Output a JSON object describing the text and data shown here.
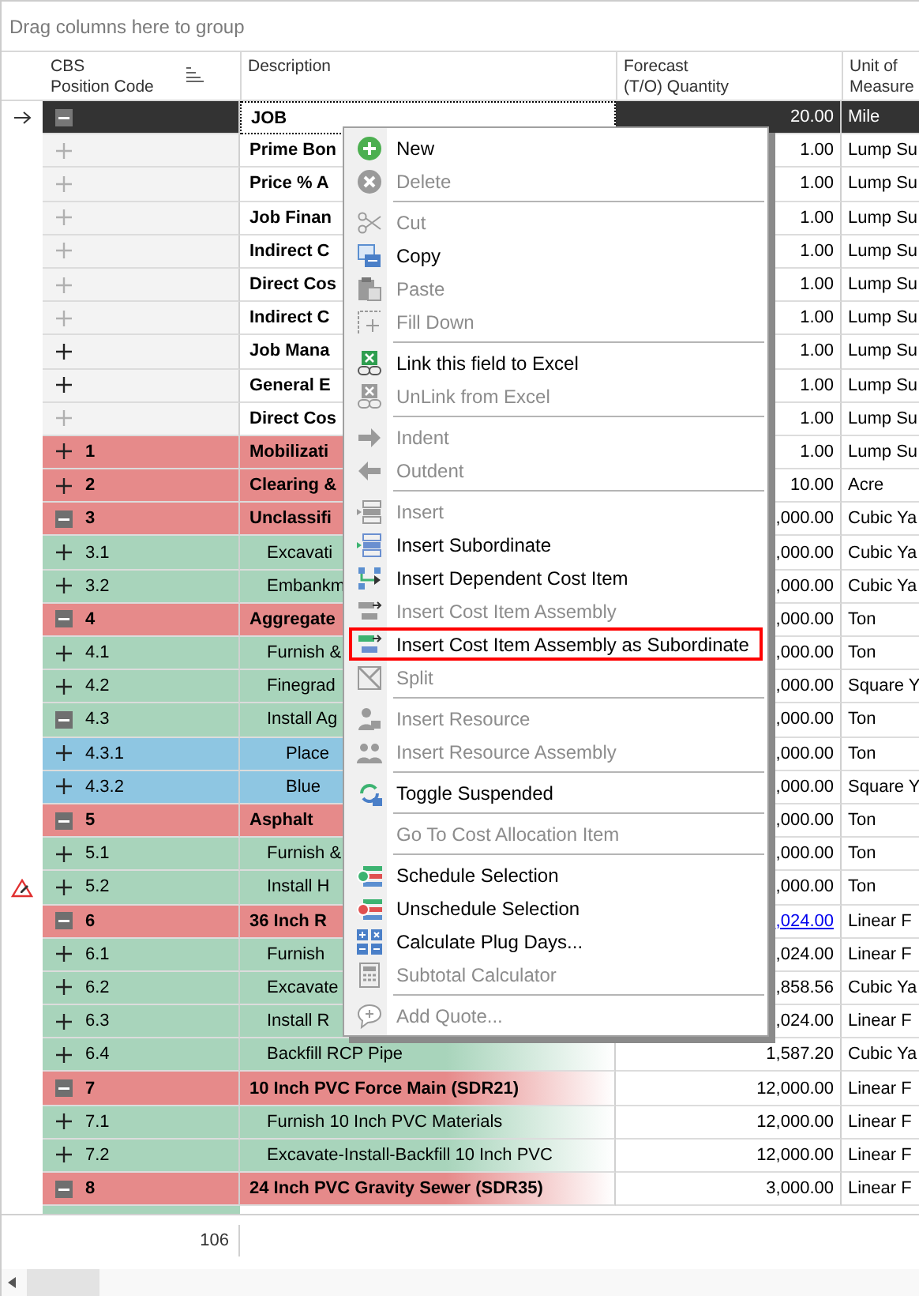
{
  "group_panel": {
    "placeholder": "Drag columns here to group"
  },
  "columns": [
    {
      "label": "CBS\nPosition Code",
      "sorted": true
    },
    {
      "label": "Description"
    },
    {
      "label": "Forecast\n(T/O) Quantity"
    },
    {
      "label": "Unit of\nMeasure"
    }
  ],
  "rows": [
    {
      "code": "",
      "description": "JOB",
      "forecast": "20.00",
      "unit": "Mile",
      "kind": "job",
      "expanded": true,
      "disabled": false,
      "selected": true,
      "link": false,
      "current": true,
      "warning": false
    },
    {
      "code": "",
      "description": "Prime Bon",
      "forecast": "1.00",
      "unit": "Lump Su",
      "kind": "plain",
      "expanded": false,
      "disabled": true,
      "selected": false,
      "link": false,
      "current": false,
      "warning": false
    },
    {
      "code": "",
      "description": "Price % A",
      "forecast": "1.00",
      "unit": "Lump Su",
      "kind": "plain",
      "expanded": false,
      "disabled": true,
      "selected": false,
      "link": false,
      "current": false,
      "warning": false
    },
    {
      "code": "",
      "description": "Job Finan",
      "forecast": "1.00",
      "unit": "Lump Su",
      "kind": "plain",
      "expanded": false,
      "disabled": true,
      "selected": false,
      "link": false,
      "current": false,
      "warning": false
    },
    {
      "code": "",
      "description": "Indirect C",
      "forecast": "1.00",
      "unit": "Lump Su",
      "kind": "plain",
      "expanded": false,
      "disabled": true,
      "selected": false,
      "link": false,
      "current": false,
      "warning": false
    },
    {
      "code": "",
      "description": "Direct Cos",
      "forecast": "1.00",
      "unit": "Lump Su",
      "kind": "plain",
      "expanded": false,
      "disabled": true,
      "selected": false,
      "link": false,
      "current": false,
      "warning": false
    },
    {
      "code": "",
      "description": "Indirect C",
      "forecast": "1.00",
      "unit": "Lump Su",
      "kind": "plain",
      "expanded": false,
      "disabled": true,
      "selected": false,
      "link": false,
      "current": false,
      "warning": false
    },
    {
      "code": "",
      "description": "Job Mana",
      "forecast": "1.00",
      "unit": "Lump Su",
      "kind": "plain",
      "expanded": false,
      "disabled": false,
      "selected": false,
      "link": false,
      "current": false,
      "warning": false
    },
    {
      "code": "",
      "description": "General E",
      "forecast": "1.00",
      "unit": "Lump Su",
      "kind": "plain",
      "expanded": false,
      "disabled": false,
      "selected": false,
      "link": false,
      "current": false,
      "warning": false
    },
    {
      "code": "",
      "description": "Direct Cos",
      "forecast": "1.00",
      "unit": "Lump Su",
      "kind": "plain",
      "expanded": false,
      "disabled": true,
      "selected": false,
      "link": false,
      "current": false,
      "warning": false
    },
    {
      "code": "1",
      "description": "Mobilizati",
      "forecast": "1.00",
      "unit": "Lump Su",
      "kind": "section",
      "expanded": false,
      "disabled": false,
      "selected": false,
      "link": false,
      "current": false,
      "warning": false
    },
    {
      "code": "2",
      "description": "Clearing &",
      "forecast": "10.00",
      "unit": "Acre",
      "kind": "section",
      "expanded": false,
      "disabled": false,
      "selected": false,
      "link": false,
      "current": false,
      "warning": false
    },
    {
      "code": "3",
      "description": "Unclassifi",
      "forecast": ",000.00",
      "unit": "Cubic Ya",
      "kind": "section",
      "expanded": true,
      "disabled": false,
      "selected": false,
      "link": false,
      "current": false,
      "warning": false
    },
    {
      "code": "3.1",
      "description": "Excavati",
      "forecast": ",000.00",
      "unit": "Cubic Ya",
      "kind": "item",
      "expanded": false,
      "disabled": false,
      "selected": false,
      "link": false,
      "current": false,
      "warning": false
    },
    {
      "code": "3.2",
      "description": "Embankm",
      "forecast": ",000.00",
      "unit": "Cubic Ya",
      "kind": "item",
      "expanded": false,
      "disabled": false,
      "selected": false,
      "link": false,
      "current": false,
      "warning": false
    },
    {
      "code": "4",
      "description": "Aggregate",
      "forecast": ",000.00",
      "unit": "Ton",
      "kind": "section",
      "expanded": true,
      "disabled": false,
      "selected": false,
      "link": false,
      "current": false,
      "warning": false
    },
    {
      "code": "4.1",
      "description": "Furnish &",
      "forecast": ",000.00",
      "unit": "Ton",
      "kind": "item",
      "expanded": false,
      "disabled": false,
      "selected": false,
      "link": false,
      "current": false,
      "warning": false
    },
    {
      "code": "4.2",
      "description": "Finegrad",
      "forecast": ",000.00",
      "unit": "Square Y",
      "kind": "item",
      "expanded": false,
      "disabled": false,
      "selected": false,
      "link": false,
      "current": false,
      "warning": false
    },
    {
      "code": "4.3",
      "description": "Install Ag",
      "forecast": ",000.00",
      "unit": "Ton",
      "kind": "item",
      "expanded": true,
      "disabled": false,
      "selected": false,
      "link": false,
      "current": false,
      "warning": false
    },
    {
      "code": "4.3.1",
      "description": "Place",
      "forecast": ",000.00",
      "unit": "Ton",
      "kind": "subitem",
      "expanded": false,
      "disabled": false,
      "selected": false,
      "link": false,
      "current": false,
      "warning": false
    },
    {
      "code": "4.3.2",
      "description": "Blue",
      "forecast": ",000.00",
      "unit": "Square Y",
      "kind": "subitem",
      "expanded": false,
      "disabled": false,
      "selected": false,
      "link": false,
      "current": false,
      "warning": false
    },
    {
      "code": "5",
      "description": "Asphalt",
      "forecast": ",000.00",
      "unit": "Ton",
      "kind": "section",
      "expanded": true,
      "disabled": false,
      "selected": false,
      "link": false,
      "current": false,
      "warning": false
    },
    {
      "code": "5.1",
      "description": "Furnish &",
      "forecast": ",000.00",
      "unit": "Ton",
      "kind": "item",
      "expanded": false,
      "disabled": false,
      "selected": false,
      "link": false,
      "current": false,
      "warning": false
    },
    {
      "code": "5.2",
      "description": "Install H",
      "forecast": ",000.00",
      "unit": "Ton",
      "kind": "item",
      "expanded": false,
      "disabled": false,
      "selected": false,
      "link": false,
      "current": false,
      "warning": true
    },
    {
      "code": "6",
      "description": "36 Inch R",
      "forecast": ",024.00",
      "unit": "Linear F",
      "kind": "section",
      "expanded": true,
      "disabled": false,
      "selected": false,
      "link": true,
      "current": false,
      "warning": false
    },
    {
      "code": "6.1",
      "description": "Furnish",
      "forecast": ",024.00",
      "unit": "Linear F",
      "kind": "item",
      "expanded": false,
      "disabled": false,
      "selected": false,
      "link": false,
      "current": false,
      "warning": false
    },
    {
      "code": "6.2",
      "description": "Excavate",
      "forecast": ",858.56",
      "unit": "Cubic Ya",
      "kind": "item",
      "expanded": false,
      "disabled": false,
      "selected": false,
      "link": false,
      "current": false,
      "warning": false
    },
    {
      "code": "6.3",
      "description": "Install R",
      "forecast": ",024.00",
      "unit": "Linear F",
      "kind": "item",
      "expanded": false,
      "disabled": false,
      "selected": false,
      "link": false,
      "current": false,
      "warning": false
    },
    {
      "code": "6.4",
      "description": "Backfill RCP Pipe",
      "forecast": "1,587.20",
      "unit": "Cubic Ya",
      "kind": "item",
      "expanded": false,
      "disabled": false,
      "selected": false,
      "link": false,
      "current": false,
      "warning": false
    },
    {
      "code": "7",
      "description": "10 Inch PVC Force Main (SDR21)",
      "forecast": "12,000.00",
      "unit": "Linear F",
      "kind": "section",
      "expanded": true,
      "disabled": false,
      "selected": false,
      "link": false,
      "current": false,
      "warning": false
    },
    {
      "code": "7.1",
      "description": "Furnish 10 Inch PVC Materials",
      "forecast": "12,000.00",
      "unit": "Linear F",
      "kind": "item",
      "expanded": false,
      "disabled": false,
      "selected": false,
      "link": false,
      "current": false,
      "warning": false
    },
    {
      "code": "7.2",
      "description": "Excavate-Install-Backfill 10 Inch PVC",
      "forecast": "12,000.00",
      "unit": "Linear F",
      "kind": "item",
      "expanded": false,
      "disabled": false,
      "selected": false,
      "link": false,
      "current": false,
      "warning": false
    },
    {
      "code": "8",
      "description": "24 Inch PVC Gravity Sewer (SDR35)",
      "forecast": "3,000.00",
      "unit": "Linear F",
      "kind": "section",
      "expanded": true,
      "disabled": false,
      "selected": false,
      "link": false,
      "current": false,
      "warning": false
    }
  ],
  "footer": {
    "count": "106"
  },
  "context_menu": {
    "groups": [
      [
        {
          "label": "New",
          "disabled": false,
          "selected": false
        },
        {
          "label": "Delete",
          "disabled": true,
          "selected": false
        }
      ],
      [
        {
          "label": "Cut",
          "disabled": true,
          "selected": false
        },
        {
          "label": "Copy",
          "disabled": false,
          "selected": false
        },
        {
          "label": "Paste",
          "disabled": true,
          "selected": false
        },
        {
          "label": "Fill Down",
          "disabled": true,
          "selected": false
        }
      ],
      [
        {
          "label": "Link this field to Excel",
          "disabled": false,
          "selected": false
        },
        {
          "label": "UnLink from Excel",
          "disabled": true,
          "selected": false
        }
      ],
      [
        {
          "label": "Indent",
          "disabled": true,
          "selected": false
        },
        {
          "label": "Outdent",
          "disabled": true,
          "selected": false
        }
      ],
      [
        {
          "label": "Insert",
          "disabled": true,
          "selected": false
        },
        {
          "label": "Insert Subordinate",
          "disabled": false,
          "selected": false
        },
        {
          "label": "Insert Dependent Cost Item",
          "disabled": false,
          "selected": false
        },
        {
          "label": "Insert Cost Item Assembly",
          "disabled": true,
          "selected": false
        },
        {
          "label": "Insert Cost Item Assembly as Subordinate",
          "disabled": false,
          "selected": true
        },
        {
          "label": "Split",
          "disabled": true,
          "selected": false
        }
      ],
      [
        {
          "label": "Insert Resource",
          "disabled": true,
          "selected": false
        },
        {
          "label": "Insert Resource Assembly",
          "disabled": true,
          "selected": false
        }
      ],
      [
        {
          "label": "Toggle Suspended",
          "disabled": false,
          "selected": false
        }
      ],
      [
        {
          "label": "Go To Cost Allocation Item",
          "disabled": true,
          "selected": false
        }
      ],
      [
        {
          "label": "Schedule Selection",
          "disabled": false,
          "selected": false
        },
        {
          "label": "Unschedule Selection",
          "disabled": false,
          "selected": false
        },
        {
          "label": "Calculate Plug Days...",
          "disabled": false,
          "selected": false
        },
        {
          "label": "Subtotal Calculator",
          "disabled": true,
          "selected": false
        }
      ],
      [
        {
          "label": "Add Quote...",
          "disabled": true,
          "selected": false
        }
      ]
    ]
  }
}
